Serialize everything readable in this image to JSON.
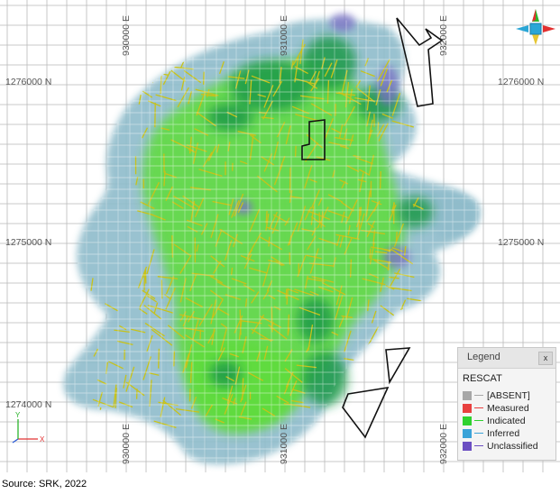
{
  "map": {
    "easting_labels": [
      "930000 E",
      "931000 E",
      "932000 E"
    ],
    "northing_labels": [
      "1276000 N",
      "1275000 N",
      "1274000 N"
    ],
    "colors": {
      "inferred_fill": "#8fbccb",
      "indicated_fill": "#5edc3a",
      "measured_fill": "#1f9a4a",
      "unclassified_fill": "#7a6fc4",
      "drillhole_trace": "#c7c21a",
      "outline": "#111111",
      "grid_major": "#b9b9b9",
      "grid_minor": "#d8d8d8"
    }
  },
  "legend": {
    "title": "Legend",
    "close_label": "x",
    "field": "RESCAT",
    "items": [
      {
        "label": "[ABSENT]",
        "swatch": "#a7a7a7",
        "line": "#a7a7a7"
      },
      {
        "label": "Measured",
        "swatch": "#e8403f",
        "line": "#e8403f"
      },
      {
        "label": "Indicated",
        "swatch": "#2fd12f",
        "line": "#2fd12f"
      },
      {
        "label": "Inferred",
        "swatch": "#3aa3d8",
        "line": "#3aa3d8"
      },
      {
        "label": "Unclassified",
        "swatch": "#6b4fc2",
        "line": "#6b4fc2"
      }
    ]
  },
  "compass": {
    "icon": "view-orientation-gizmo-icon"
  },
  "axis_triad": {
    "icon": "xyz-axis-triad-icon",
    "x_label": "X",
    "y_label": "Y"
  },
  "caption": "Source: SRK, 2022"
}
